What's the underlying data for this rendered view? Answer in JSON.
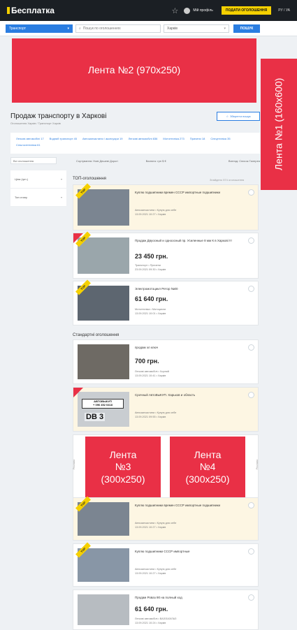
{
  "header": {
    "logo": "Бесплатка",
    "profile": "Мій профіль",
    "post_button": "ПОДАТИ ОГОЛОШЕННЯ",
    "lang": "РУ / УА"
  },
  "search": {
    "category": "Транспорт",
    "placeholder": "Пошук по оголошеннях",
    "city": "Харків",
    "button": "ПОШУК"
  },
  "ads": {
    "ad1": "Лента №1 (160x600)",
    "ad2": "Лента №2 (970x250)",
    "ad3": "Лента\n№3\n(300x250)",
    "ad4": "Лента\n№4\n(300x250)"
  },
  "page": {
    "title": "Продаж транспорту в Харкові",
    "breadcrumbs": "Оголошення Харків / Транспорт Харків",
    "save_search": "Зберегти пошук"
  },
  "subcategories": [
    "Легкові автомобілі 17",
    "Водний транспорт 45",
    "Автозапчастини / аксесуари 19",
    "Легкові автомобілі 836",
    "Мототехніка 273",
    "Причепи 18",
    "Спецтехніка 35",
    "Сільгосптехніка 61"
  ],
  "filters": {
    "all": "Всі оголошення",
    "sort": "Сортування:  Нові  Дешеві  Дорогі",
    "price": "Валюта:  грн  $  €",
    "view": "Вигляд:  Список  Галерея"
  },
  "sidebar": [
    {
      "label": "Ціна (грн.)"
    },
    {
      "label": "Тип стану"
    }
  ],
  "sections": {
    "top": "ТОП-оголошення",
    "standard": "Стандартні оголошення",
    "found": "Знайдено 574 оголошення",
    "top_badge": "TOP",
    "ad_label": "Реклама"
  },
  "listings": [
    {
      "title": "Куплю подшипники времен СССР импортные подшипники",
      "price": "",
      "meta1": "Автозапчастини • Купую для себе",
      "meta2": "13.09.2021 10:27 • Харків"
    },
    {
      "title": "Продаж Двуосный и одноосный пр. Усиленные 8 мм К в Харкові !!!",
      "price": "23 450 грн.",
      "meta1": "Транспорт • Причепи",
      "meta2": "23.09.2021 09:30 • Харків"
    },
    {
      "title": "Электромотоцикл Ретор №00",
      "price": "61 640 грн.",
      "meta1": "Мототехніка • Мотоцикли",
      "meta2": "13.09.2021 10:01 • Харків"
    },
    {
      "title": "продам эл ключ",
      "price": "700 грн.",
      "meta1": "Легкові автомобілі • Чорний",
      "meta2": "13.09.2021 10:41 • Харків"
    },
    {
      "title": "Срочный АвтоВыКУП. Харьков и область",
      "price": "",
      "meta1": "Автозапчастини • Купую для себе",
      "meta2": "13.09.2021 09:55 • Харків"
    },
    {
      "title": "Куплю подшипники времен СССР импортные подшипники",
      "price": "",
      "meta1": "Автозапчастини • Купую для себе",
      "meta2": "13.09.2021 10:27 • Харків"
    },
    {
      "title": "Куплю подшипники СССР импортные",
      "price": "",
      "meta1": "Автозапчастини • Купую для себе",
      "meta2": "13.09.2021 10:27 • Харків"
    },
    {
      "title": "Продам Роваз 90 на полный ход",
      "price": "61 640 грн.",
      "meta1": "Легкові автомобілі • ВАЗ/ЗАЗ/ЛАЗ",
      "meta2": "13.09.2021 10:24 • Харків"
    }
  ],
  "plate": {
    "line1": "АВТОВЫКУП",
    "line2": "+ 096 452 0418",
    "db": "DB 3"
  },
  "colors": {
    "accent": "#2a7de1",
    "yellow": "#f5d000",
    "ad": "#e93046"
  }
}
